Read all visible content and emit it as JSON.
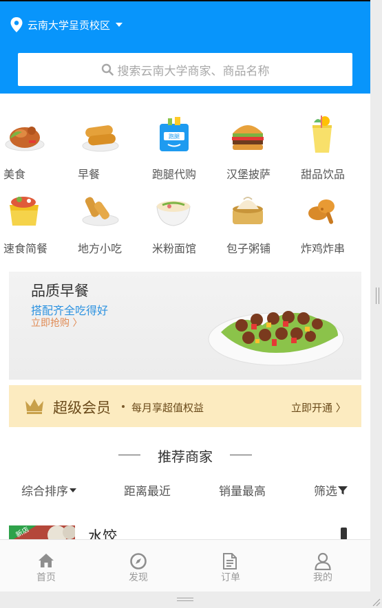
{
  "header": {
    "location": "云南大学呈贡校区",
    "search_placeholder": "搜索云南大学商家、商品名称",
    "bg_color": "#0895fb"
  },
  "categories": [
    {
      "label": "美食",
      "icon": "roast-chicken-icon"
    },
    {
      "label": "早餐",
      "icon": "bread-icon"
    },
    {
      "label": "跑腿代购",
      "icon": "errand-bag-icon"
    },
    {
      "label": "汉堡披萨",
      "icon": "burger-icon"
    },
    {
      "label": "甜品饮品",
      "icon": "drink-icon"
    },
    {
      "label": "速食简餐",
      "icon": "fast-food-icon"
    },
    {
      "label": "地方小吃",
      "icon": "spring-roll-icon"
    },
    {
      "label": "米粉面馆",
      "icon": "noodle-bowl-icon"
    },
    {
      "label": "包子粥铺",
      "icon": "steamed-bun-icon"
    },
    {
      "label": "炸鸡炸串",
      "icon": "fried-chicken-icon"
    }
  ],
  "banner": {
    "title": "品质早餐",
    "subtitle": "搭配齐全吃得好",
    "cta": "立即抢购 〉",
    "title_color": "#333333",
    "subtitle_color": "#2c92e0",
    "cta_color": "#e08a53"
  },
  "vip": {
    "name": "超级会员",
    "desc": "每月享超值权益",
    "open": "立即开通 〉",
    "bg_color": "#fcebc0"
  },
  "recommend": {
    "title": "推荐商家",
    "sorts": [
      "综合排序",
      "距离最近",
      "销量最高",
      "筛选"
    ]
  },
  "shop_peek": {
    "name": "水饺",
    "badge": "新店"
  },
  "tabbar": [
    {
      "label": "首页",
      "icon": "home-icon"
    },
    {
      "label": "发现",
      "icon": "compass-icon"
    },
    {
      "label": "订单",
      "icon": "order-icon"
    },
    {
      "label": "我的",
      "icon": "user-icon"
    }
  ]
}
